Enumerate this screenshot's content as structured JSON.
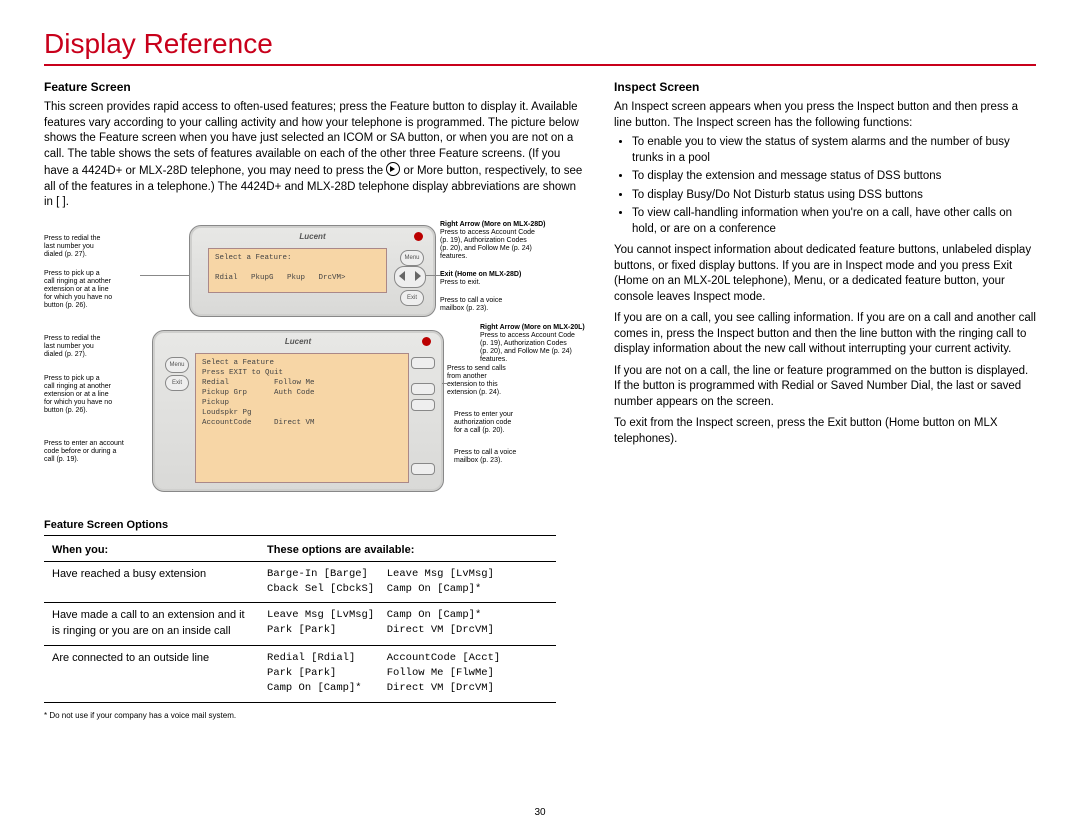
{
  "page_title": "Display Reference",
  "page_number": "30",
  "left": {
    "heading": "Feature Screen",
    "para": "This screen provides rapid access to often-used features; press the Feature button to display it. Available features vary according to your calling activity and how your telephone is programmed. The picture below shows the Feature screen when you have just selected an ICOM or SA button, or when you are not on a call. The table shows the sets of features available on each of the other three Feature screens. (If you have a 4424D+ or MLX-28D telephone, you may need to press the ",
    "para_tail": " or More button, respectively, to see all of the features in a telephone.) The 4424D+ and MLX-28D telephone display abbreviations are shown in [ ]."
  },
  "right": {
    "heading": "Inspect Screen",
    "intro": "An Inspect screen appears when you press the Inspect button and then press a line button. The Inspect screen has the following functions:",
    "bullets": [
      "To enable you to view the status of system alarms and the number of busy trunks in a pool",
      "To display the extension and message status of DSS buttons",
      "To display Busy/Do Not Disturb status using DSS buttons",
      "To view call-handling information when you're on a call, have other calls on hold, or are on a conference"
    ],
    "p1": "You cannot inspect information about dedicated feature buttons, unlabeled display buttons, or fixed display buttons. If you are in Inspect mode and you press Exit (Home on an MLX-20L telephone), Menu, or a dedicated feature button, your console leaves Inspect mode.",
    "p2": "If you are on a call, you see calling information. If you are on a call and another call comes in, press the Inspect button and then the line button with the ringing call to display information about the new call without interrupting your current activity.",
    "p3": "If you are not on a call, the line or feature programmed on the button is displayed. If the button is programmed with Redial or Saved Number Dial, the last or saved number appears on the screen.",
    "p4": "To exit from the Inspect screen, press the Exit button (Home button on MLX telephones)."
  },
  "fig": {
    "brand": "Lucent",
    "menu_btn": "Menu",
    "exit_btn": "Exit",
    "top_screen": "Select a Feature:\n\nRdial   PkupG   Pkup   DrcVM>",
    "bot_screen": "Select a Feature\nPress EXIT to Quit\nRedial          Follow Me\nPickup Grp      Auth Code\nPickup\nLoudspkr Pg\nAccountCode     Direct VM",
    "callouts_left": {
      "c1": "Press to redial the\nlast number you\ndialed (p. 27).",
      "c2": "Press to pick up a\ncall ringing at another\nextension or at a line\nfor which you have no\nbutton (p. 26).",
      "c3": "Press to redial the\nlast number you\ndialed (p. 27).",
      "c4": "Press to pick up a\ncall ringing at another\nextension or at a line\nfor which you have no\nbutton (p. 26).",
      "c5": "Press to enter an account\ncode before or during a\ncall (p. 19)."
    },
    "callouts_right": {
      "r1_bold": "Right Arrow (More on MLX-28D)",
      "r1": "Press to access Account Code\n(p. 19), Authorization Codes\n(p. 20), and Follow Me (p. 24)\nfeatures.",
      "r2_bold": "Exit (Home on MLX-28D)",
      "r2": "Press to exit.",
      "r3": "Press to call a voice\nmailbox (p. 23).",
      "r4_bold": "Right Arrow (More on MLX-20L)",
      "r4": "Press to access Account Code\n(p. 19), Authorization Codes\n(p. 20), and Follow Me (p. 24)\nfeatures.",
      "r5": "Press to send calls\nfrom another\nextension to this\nextension (p. 24).",
      "r6": "Press to enter your\nauthorization code\nfor a call (p. 20).",
      "r7": "Press to call a voice\nmailbox (p. 23)."
    }
  },
  "table": {
    "title": "Feature Screen Options",
    "col1": "When you:",
    "col2": "These options are available:",
    "rows": [
      {
        "when": "Have reached a busy extension",
        "opts": "Barge-In [Barge]   Leave Msg [LvMsg]\nCback Sel [CbckS]  Camp On [Camp]*"
      },
      {
        "when": "Have made a call to an extension and it is ringing or you are on an inside call",
        "opts": "Leave Msg [LvMsg]  Camp On [Camp]*\nPark [Park]        Direct VM [DrcVM]"
      },
      {
        "when": "Are connected to an outside line",
        "opts": "Redial [Rdial]     AccountCode [Acct]\nPark [Park]        Follow Me [FlwMe]\nCamp On [Camp]*    Direct VM [DrcVM]"
      }
    ],
    "footnote": "*  Do not use if your company has a voice mail system."
  }
}
